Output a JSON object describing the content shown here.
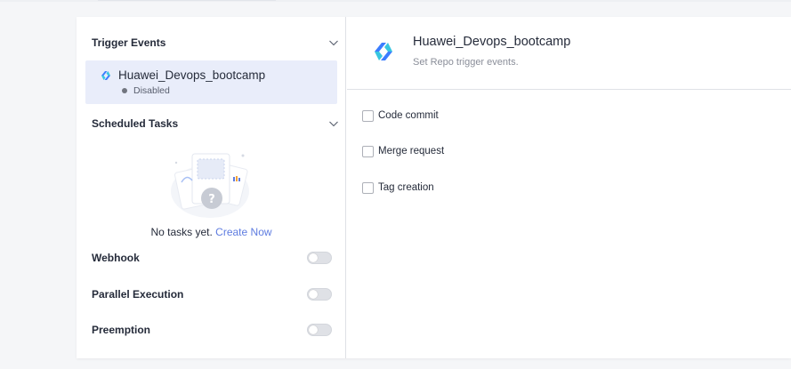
{
  "left_panel": {
    "trigger_events": {
      "title": "Trigger Events",
      "pipeline": {
        "name": "Huawei_Devops_bootcamp",
        "status": "Disabled"
      }
    },
    "scheduled_tasks": {
      "title": "Scheduled Tasks",
      "empty_text": "No tasks yet.",
      "create_link": "Create Now"
    },
    "toggles": [
      {
        "label": "Webhook",
        "enabled": false
      },
      {
        "label": "Parallel Execution",
        "enabled": false
      },
      {
        "label": "Preemption",
        "enabled": false
      }
    ]
  },
  "right_panel": {
    "title": "Huawei_Devops_bootcamp",
    "subtitle": "Set Repo trigger events.",
    "events": [
      {
        "label": "Code commit",
        "checked": false
      },
      {
        "label": "Merge request",
        "checked": false
      },
      {
        "label": "Tag creation",
        "checked": false
      }
    ]
  },
  "colors": {
    "accent": "#5e7ce0",
    "selected_bg": "#e9edfa",
    "logo_blue": "#3b7dff",
    "logo_cyan": "#37c6e0"
  }
}
